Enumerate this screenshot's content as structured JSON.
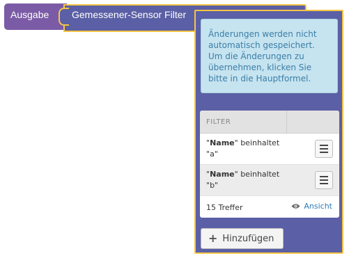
{
  "output_block": {
    "label": "Ausgabe"
  },
  "filter_block": {
    "label": "Gemessener-Sensor Filter"
  },
  "panel": {
    "info_text": "Änderungen werden nicht automatisch gespeichert. Um die Änderungen zu übernehmen, klicken Sie bitte in die Hauptformel.",
    "table": {
      "header": "FILTER",
      "rows": [
        {
          "field": "Name",
          "op": "beinhaltet",
          "value": "a"
        },
        {
          "field": "Name",
          "op": "beinhaltet",
          "value": "b"
        }
      ],
      "result_count": "15 Treffer",
      "view_label": "Ansicht"
    },
    "add_button_label": "Hinzufügen"
  },
  "colors": {
    "output_block": "#7b5ba6",
    "filter_block": "#5b5fa5",
    "highlight_border": "#f6c544",
    "info_bg": "#c6e3f0",
    "link": "#2c7bb6"
  },
  "icons": [
    "eye-icon",
    "menu-icon",
    "plus-icon"
  ]
}
